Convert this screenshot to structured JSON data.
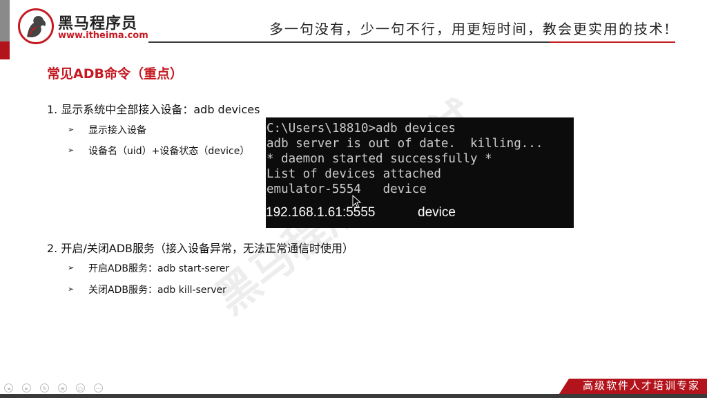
{
  "brand": {
    "name": "黑马程序员",
    "url": "www.itheima.com",
    "accent": "#c51a22"
  },
  "header": {
    "slogan": "多一句没有，少一句不行，用更短时间，教会更实用的技术!"
  },
  "section": {
    "title": "常见ADB命令（重点）"
  },
  "items": [
    {
      "label": "1. 显示系统中全部接入设备：adb devices",
      "subs": [
        "显示接入设备",
        "设备名（uid）+设备状态（device）"
      ]
    },
    {
      "label": "2. 开启/关闭ADB服务（接入设备异常，无法正常通信时使用）",
      "subs": [
        "开启ADB服务：adb start-serer",
        "关闭ADB服务：adb kill-server"
      ]
    }
  ],
  "terminal": {
    "lines": [
      "C:\\Users\\18810>adb devices",
      "adb server is out of date.  killing...",
      "* daemon started successfully *",
      "List of devices attached",
      "emulator-5554   device"
    ],
    "ip": "192.168.1.61:5555",
    "ip_status": "device"
  },
  "watermark": "黑马程序员 测试",
  "footer": {
    "tag": "高级软件人才培训专家"
  },
  "controls": [
    "prev-icon",
    "next-icon",
    "pen-icon",
    "menu-icon",
    "zoom-icon",
    "more-icon"
  ]
}
